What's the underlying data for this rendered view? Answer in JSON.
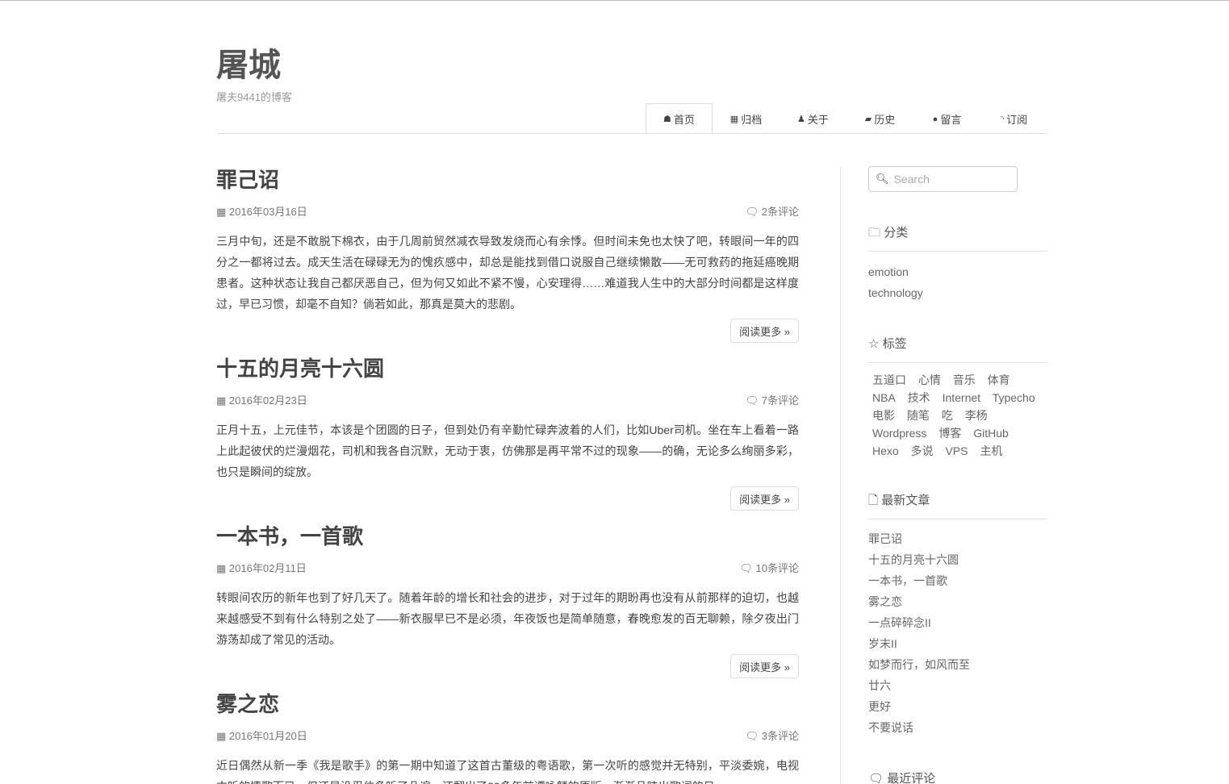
{
  "site": {
    "title": "屠城",
    "subtitle": "屠夫9441的博客"
  },
  "nav": [
    {
      "label": "首页",
      "icon": "home-icon",
      "glyph": "☗"
    },
    {
      "label": "归档",
      "icon": "archive-icon",
      "glyph": "▦"
    },
    {
      "label": "关于",
      "icon": "user-icon",
      "glyph": "♟"
    },
    {
      "label": "历史",
      "icon": "book-icon",
      "glyph": "▰"
    },
    {
      "label": "留言",
      "icon": "comments-icon",
      "glyph": "●"
    },
    {
      "label": "订阅",
      "icon": "rss-icon",
      "glyph": "◝"
    }
  ],
  "posts": [
    {
      "title": "罪己诏",
      "date": "2016年03月16日",
      "comments": "2条评论",
      "body": "三月中旬，还是不敢脱下棉衣，由于几周前贸然减衣导致发烧而心有余悸。但时间未免也太快了吧，转眼间一年的四分之一都将过去。成天生活在碌碌无为的愧疚感中，却总是能找到借口说服自己继续懒散——无可救药的拖延癌晚期患者。这种状态让我自己都厌恶自己，但为何又如此不紧不慢，心安理得……难道我人生中的大部分时间都是这样度过，早已习惯，却毫不自知？倘若如此，那真是莫大的悲剧。",
      "more": "阅读更多 »"
    },
    {
      "title": "十五的月亮十六圆",
      "date": "2016年02月23日",
      "comments": "7条评论",
      "body": "正月十五，上元佳节，本该是个团圆的日子，但到处仍有辛勤忙碌奔波着的人们，比如Uber司机。坐在车上看着一路上此起彼伏的烂漫烟花，司机和我各自沉默，无动于衷，仿佛那是再平常不过的现象——的确，无论多么绚丽多彩，也只是瞬间的绽放。",
      "more": "阅读更多 »"
    },
    {
      "title": "一本书，一首歌",
      "date": "2016年02月11日",
      "comments": "10条评论",
      "body": "转眼间农历的新年也到了好几天了。随着年龄的增长和社会的进步，对于过年的期盼再也没有从前那样的迫切，也越来越感受不到有什么特别之处了——新衣服早已不是必须，年夜饭也是简单随意，春晚愈发的百无聊赖，除夕夜出门游荡却成了常见的活动。",
      "more": "阅读更多 »"
    },
    {
      "title": "雾之恋",
      "date": "2016年01月20日",
      "comments": "3条评论",
      "body": "近日偶然从新一季《我是歌手》的第一期中知道了这首古董级的粤语歌，第一次听的感觉并无特别，平淡委婉，电视中听的情歌而已，但还是没忍住多听了几遍，还翻出了20多年前谭咏麟的原版，渐渐品味出歌词的日"
    }
  ],
  "sidebar": {
    "search_placeholder": "Search",
    "categories": {
      "title": "分类",
      "items": [
        "emotion",
        "technology"
      ]
    },
    "tags": {
      "title": "标签",
      "items": [
        "五道口",
        "心情",
        "音乐",
        "体育",
        "NBA",
        "技术",
        "Internet",
        "Typecho",
        "电影",
        "随笔",
        "吃",
        "李杨",
        "Wordpress",
        "博客",
        "GitHub",
        "Hexo",
        "多说",
        "VPS",
        "主机"
      ]
    },
    "recent": {
      "title": "最新文章",
      "items": [
        "罪己诏",
        "十五的月亮十六圆",
        "一本书，一首歌",
        "雾之恋",
        "一点碎碎念II",
        "岁末II",
        "如梦而行，如风而至",
        "廿六",
        "更好",
        "不要说话"
      ]
    },
    "comments": {
      "title": "最近评论"
    }
  }
}
